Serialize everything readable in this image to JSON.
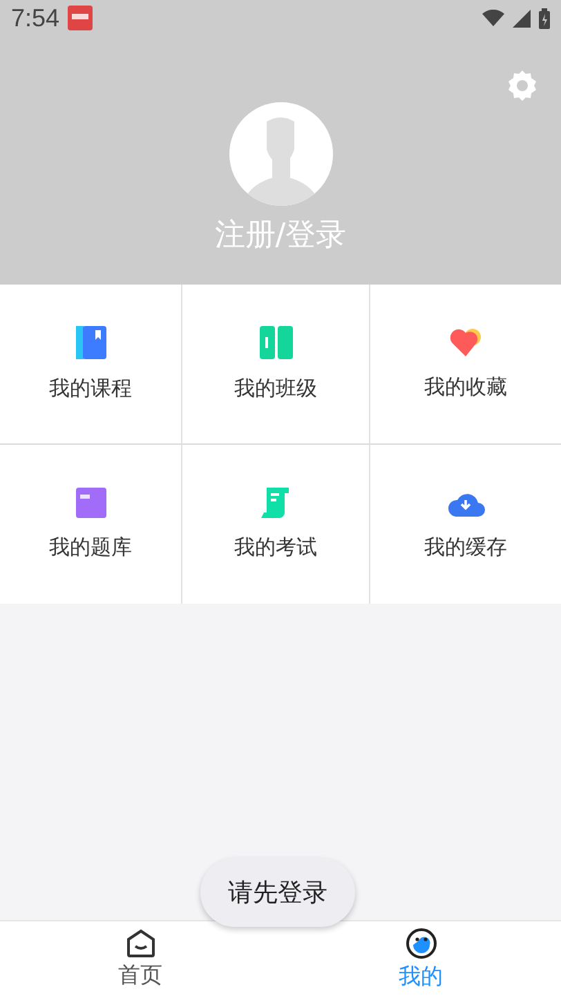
{
  "status_bar": {
    "time": "7:54"
  },
  "profile": {
    "login_label": "注册/登录"
  },
  "menu": [
    {
      "kind": "book",
      "label": "我的课程"
    },
    {
      "kind": "class",
      "label": "我的班级"
    },
    {
      "kind": "heart",
      "label": "我的收藏"
    },
    {
      "kind": "bank",
      "label": "我的题库"
    },
    {
      "kind": "exam",
      "label": "我的考试"
    },
    {
      "kind": "cloud",
      "label": "我的缓存"
    }
  ],
  "toast": "请先登录",
  "tabs": [
    {
      "kind": "home",
      "label": "首页",
      "selected": false
    },
    {
      "kind": "me",
      "label": "我的",
      "selected": true
    }
  ]
}
